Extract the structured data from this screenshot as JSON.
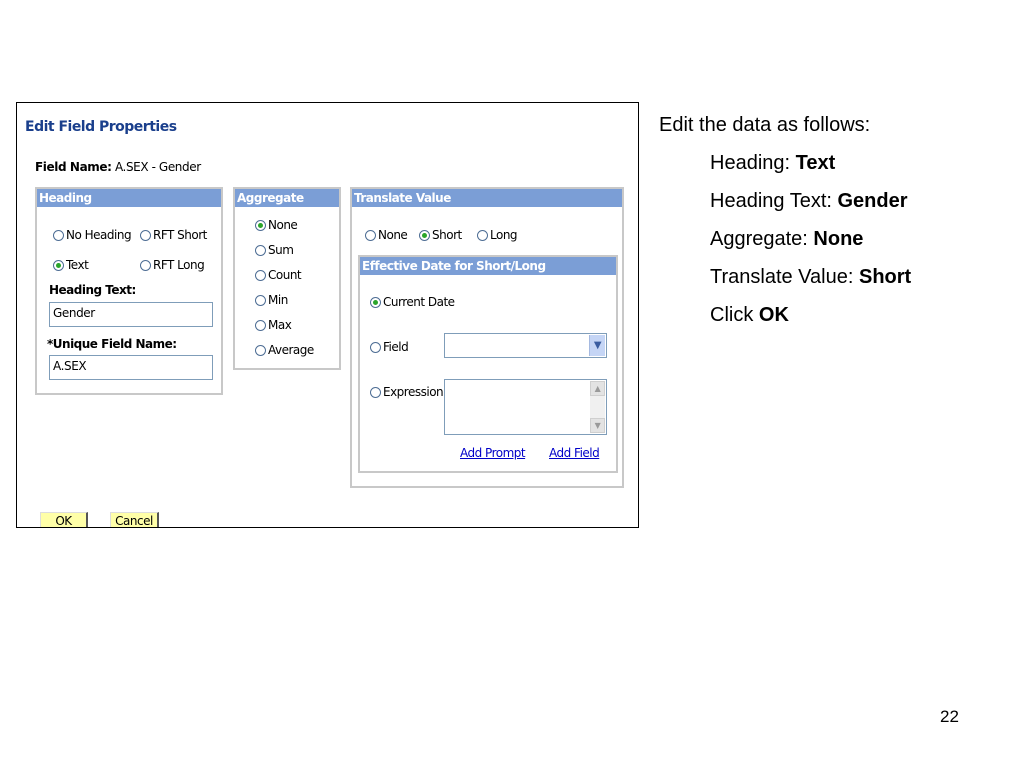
{
  "dialog": {
    "title": "Edit Field Properties",
    "field_name_label": "Field Name:",
    "field_name_value": "A.SEX - Gender",
    "heading": {
      "group_title": "Heading",
      "options": [
        {
          "label": "No Heading",
          "selected": false
        },
        {
          "label": "RFT Short",
          "selected": false
        },
        {
          "label": "Text",
          "selected": true
        },
        {
          "label": "RFT Long",
          "selected": false
        }
      ],
      "heading_text_label": "Heading Text:",
      "heading_text_value": "Gender",
      "unique_field_label": "*Unique Field Name:",
      "unique_field_value": "A.SEX"
    },
    "aggregate": {
      "group_title": "Aggregate",
      "options": [
        {
          "label": "None",
          "selected": true
        },
        {
          "label": "Sum",
          "selected": false
        },
        {
          "label": "Count",
          "selected": false
        },
        {
          "label": "Min",
          "selected": false
        },
        {
          "label": "Max",
          "selected": false
        },
        {
          "label": "Average",
          "selected": false
        }
      ]
    },
    "translate": {
      "group_title": "Translate Value",
      "options": [
        {
          "label": "None",
          "selected": false
        },
        {
          "label": "Short",
          "selected": true
        },
        {
          "label": "Long",
          "selected": false
        }
      ],
      "effective_date": {
        "group_title": "Effective Date for Short/Long",
        "options": [
          {
            "label": "Current Date",
            "selected": true
          },
          {
            "label": "Field",
            "selected": false
          },
          {
            "label": "Expression",
            "selected": false
          }
        ],
        "add_prompt": "Add Prompt",
        "add_field": "Add Field"
      }
    },
    "buttons": {
      "ok": "OK",
      "cancel": "Cancel"
    }
  },
  "instructions": {
    "intro": "Edit the data as follows:",
    "steps": [
      {
        "label": "Heading:",
        "value": "Text"
      },
      {
        "label": "Heading Text:",
        "value": "Gender"
      },
      {
        "label": "Aggregate:",
        "value": "None"
      },
      {
        "label": "Translate Value:",
        "value": "Short"
      },
      {
        "label": "Click",
        "value": "OK"
      }
    ]
  },
  "page_number": "22",
  "colors": {
    "group_header": "#7b9ed6",
    "title": "#1a3f8c",
    "button": "#ffffa8",
    "radio_selected": "#2aa52a",
    "link": "#0000c8"
  }
}
